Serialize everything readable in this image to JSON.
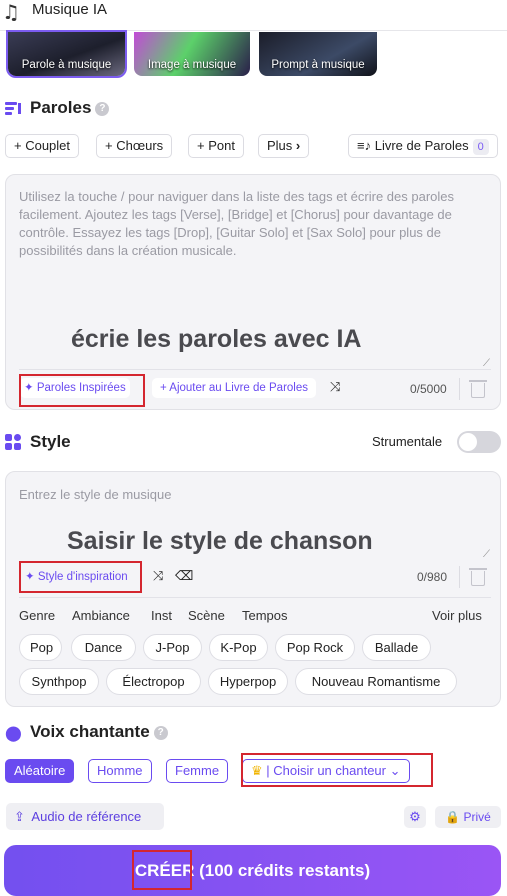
{
  "header": {
    "title": "Musique IA"
  },
  "modes": [
    "Parole à musique",
    "Image à musique",
    "Prompt à musique"
  ],
  "lyrics": {
    "title": "Paroles",
    "chips": [
      "+ Couplet",
      "+ Chœurs",
      "+ Pont",
      "Plus"
    ],
    "lyrics_book": {
      "label": "Livre de Paroles",
      "count": "0"
    },
    "placeholder": "Utilisez la touche / pour naviguer dans la liste des tags et écrire des paroles facilement. Ajoutez les tags [Verse], [Bridge] et [Chorus] pour davantage de contrôle. Essayez les tags [Drop], [Guitar Solo] et [Sax Solo] pour plus de possibilités dans la création musicale.",
    "overlay": "écrie les paroles avec IA",
    "inspired_label": "Paroles Inspirées",
    "add_book_label": "+ Ajouter au Livre de Paroles",
    "counter": "0/5000"
  },
  "style": {
    "title": "Style",
    "instrumental_label": "Strumentale",
    "instrumental_on": false,
    "placeholder": "Entrez le style de musique",
    "overlay": "Saisir le style de chanson",
    "inspiration_label": "Style d'inspiration",
    "counter": "0/980",
    "tabs": [
      "Genre",
      "Ambiance",
      "Inst",
      "Scène",
      "Tempos"
    ],
    "active_tab": "Genre",
    "see_more": "Voir plus",
    "tags": [
      "Pop",
      "Dance",
      "J-Pop",
      "K-Pop",
      "Pop Rock",
      "Ballade",
      "Synthpop",
      "Électropop",
      "Hyperpop",
      "Nouveau Romantisme"
    ]
  },
  "voice": {
    "title": "Voix chantante",
    "options": [
      "Aléatoire",
      "Homme",
      "Femme"
    ],
    "active": "Aléatoire",
    "choose_singer": "Choisir un chanteur"
  },
  "footer": {
    "reference_audio": "Audio de référence",
    "private_label": "Privé",
    "create_label": "CRÉER",
    "credits_label": "(100 crédits restants)"
  },
  "colors": {
    "accent": "#6a4bf0",
    "highlight": "#d4262f"
  }
}
